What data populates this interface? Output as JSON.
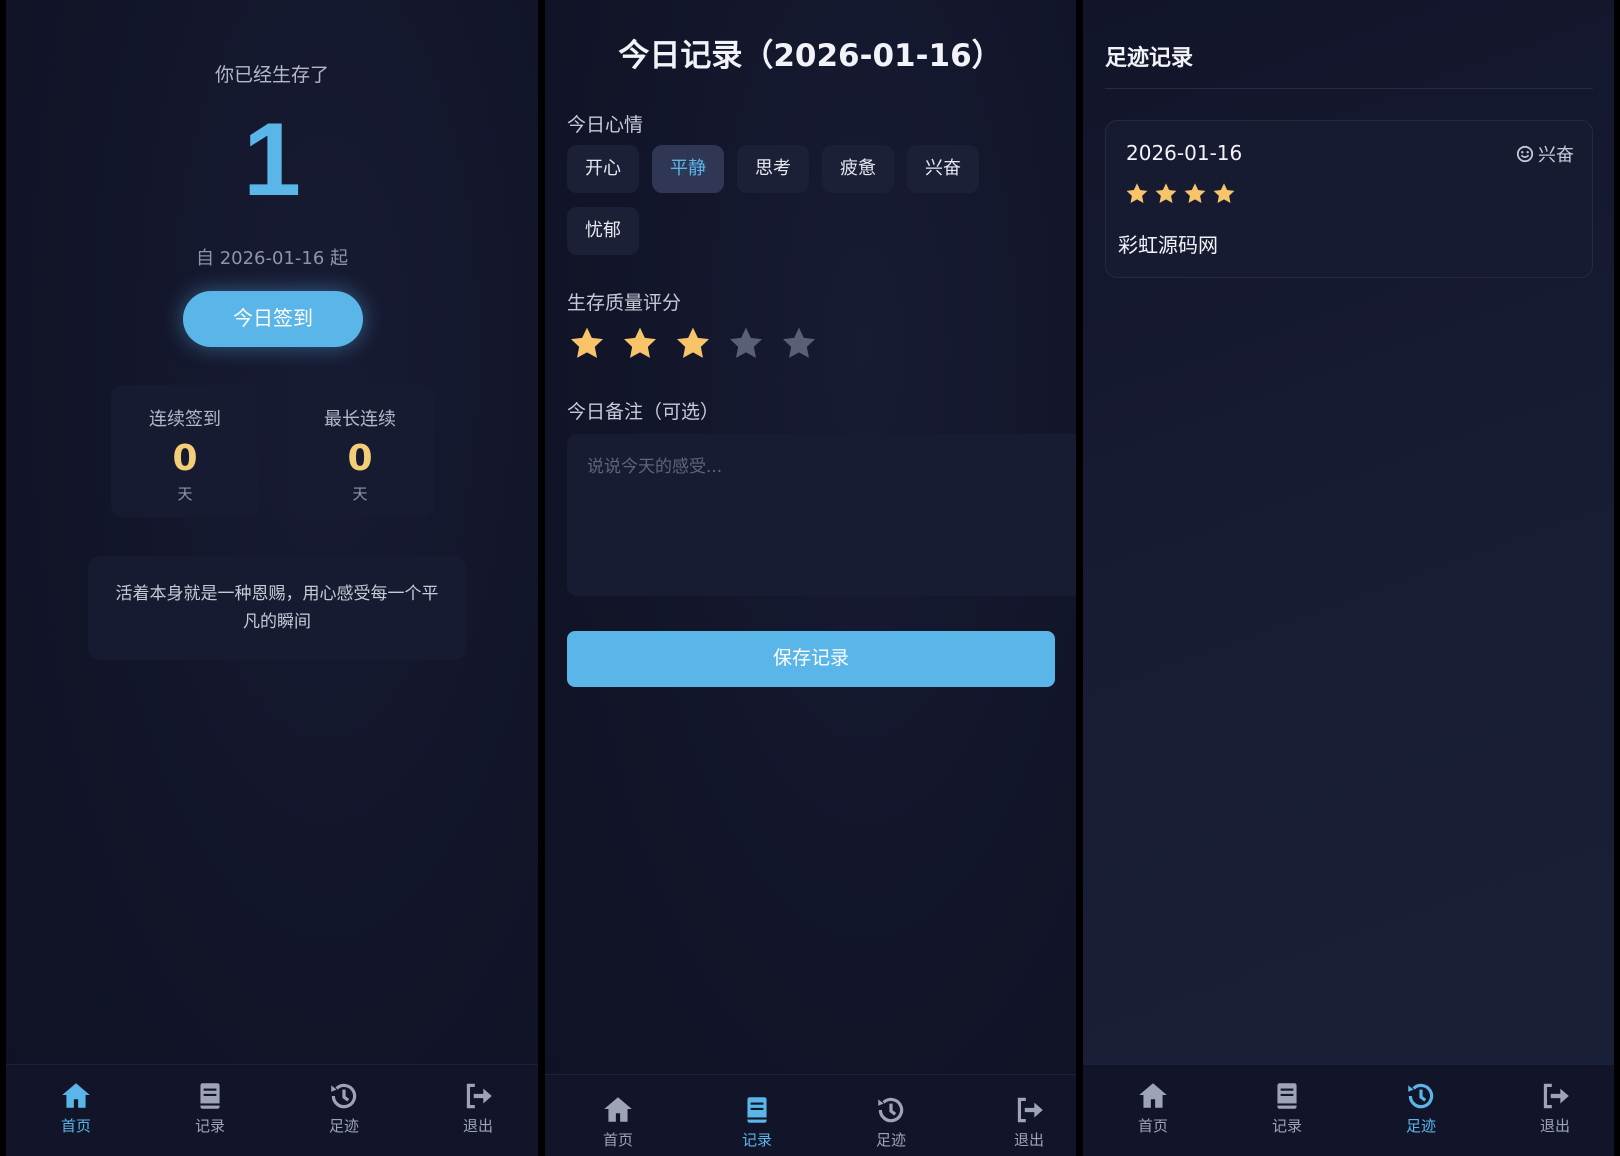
{
  "colors": {
    "accent": "#5ab6e8",
    "star_on": "#f7c46a",
    "star_off": "#5a5f78",
    "background": "#121529"
  },
  "home": {
    "survive_label": "你已经生存了",
    "days": "1",
    "since": "自 2026-01-16 起",
    "checkin_label": "今日签到",
    "streak_label": "连续签到",
    "streak_value": "0",
    "streak_unit": "天",
    "longest_label": "最长连续",
    "longest_value": "0",
    "longest_unit": "天",
    "quote": "活着本身就是一种恩赐，用心感受每一个平凡的瞬间"
  },
  "record": {
    "title": "今日记录（2026-01-16）",
    "mood_label": "今日心情",
    "moods": [
      "开心",
      "平静",
      "思考",
      "疲惫",
      "兴奋",
      "忧郁"
    ],
    "selected_mood": "平静",
    "rating_label": "生存质量评分",
    "rating": 3,
    "rating_max": 5,
    "note_label": "今日备注（可选）",
    "note_placeholder": "说说今天的感受...",
    "save_label": "保存记录"
  },
  "footprints": {
    "title": "足迹记录",
    "entries": [
      {
        "date": "2026-01-16",
        "mood": "兴奋",
        "mood_icon": "smile-icon",
        "rating": 4,
        "note": "彩虹源码网"
      }
    ]
  },
  "nav": {
    "items": [
      {
        "label": "首页",
        "icon": "home-icon"
      },
      {
        "label": "记录",
        "icon": "book-icon"
      },
      {
        "label": "足迹",
        "icon": "history-icon"
      },
      {
        "label": "退出",
        "icon": "logout-icon"
      }
    ],
    "active_by_panel": [
      "首页",
      "记录",
      "足迹"
    ]
  }
}
